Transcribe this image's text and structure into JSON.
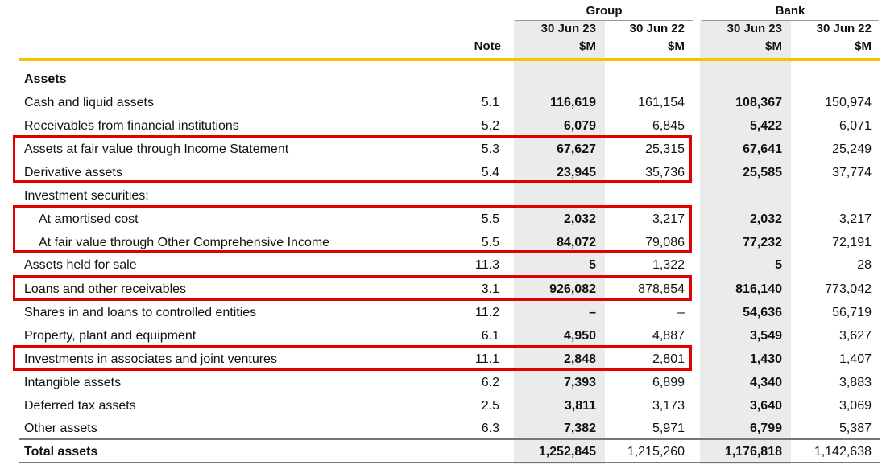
{
  "header": {
    "group_label": "Group",
    "bank_label": "Bank",
    "note_label": "Note",
    "dates": [
      "30 Jun 23",
      "30 Jun 22",
      "30 Jun 23",
      "30 Jun 22"
    ],
    "units": [
      "$M",
      "$M",
      "$M",
      "$M"
    ]
  },
  "rows": [
    {
      "label": "Assets",
      "note": "",
      "g23": "",
      "g22": "",
      "b23": "",
      "b22": ""
    },
    {
      "label": "Cash and liquid assets",
      "note": "5.1",
      "g23": "116,619",
      "g22": "161,154",
      "b23": "108,367",
      "b22": "150,974"
    },
    {
      "label": "Receivables from financial institutions",
      "note": "5.2",
      "g23": "6,079",
      "g22": "6,845",
      "b23": "5,422",
      "b22": "6,071"
    },
    {
      "label": "Assets at fair value through Income Statement",
      "note": "5.3",
      "g23": "67,627",
      "g22": "25,315",
      "b23": "67,641",
      "b22": "25,249"
    },
    {
      "label": "Derivative assets",
      "note": "5.4",
      "g23": "23,945",
      "g22": "35,736",
      "b23": "25,585",
      "b22": "37,774"
    },
    {
      "label": "Investment securities:",
      "note": "",
      "g23": "",
      "g22": "",
      "b23": "",
      "b22": ""
    },
    {
      "label": "At amortised cost",
      "note": "5.5",
      "g23": "2,032",
      "g22": "3,217",
      "b23": "2,032",
      "b22": "3,217"
    },
    {
      "label": "At fair value through Other Comprehensive Income",
      "note": "5.5",
      "g23": "84,072",
      "g22": "79,086",
      "b23": "77,232",
      "b22": "72,191"
    },
    {
      "label": "Assets held for sale",
      "note": "11.3",
      "g23": "5",
      "g22": "1,322",
      "b23": "5",
      "b22": "28"
    },
    {
      "label": "Loans and other receivables",
      "note": "3.1",
      "g23": "926,082",
      "g22": "878,854",
      "b23": "816,140",
      "b22": "773,042"
    },
    {
      "label": "Shares in and loans to controlled entities",
      "note": "11.2",
      "g23": "–",
      "g22": "–",
      "b23": "54,636",
      "b22": "56,719"
    },
    {
      "label": "Property, plant and equipment",
      "note": "6.1",
      "g23": "4,950",
      "g22": "4,887",
      "b23": "3,549",
      "b22": "3,627"
    },
    {
      "label": "Investments in associates and joint ventures",
      "note": "11.1",
      "g23": "2,848",
      "g22": "2,801",
      "b23": "1,430",
      "b22": "1,407"
    },
    {
      "label": "Intangible assets",
      "note": "6.2",
      "g23": "7,393",
      "g22": "6,899",
      "b23": "4,340",
      "b22": "3,883"
    },
    {
      "label": "Deferred tax assets",
      "note": "2.5",
      "g23": "3,811",
      "g22": "3,173",
      "b23": "3,640",
      "b22": "3,069"
    },
    {
      "label": "Other assets",
      "note": "6.3",
      "g23": "7,382",
      "g22": "5,971",
      "b23": "6,799",
      "b22": "5,387"
    },
    {
      "label": "Total assets",
      "note": "",
      "g23": "1,252,845",
      "g22": "1,215,260",
      "b23": "1,176,818",
      "b22": "1,142,638"
    }
  ],
  "colors": {
    "highlight_box": "#e00000",
    "rule": "#f6c200",
    "shade": "#ebebeb"
  }
}
